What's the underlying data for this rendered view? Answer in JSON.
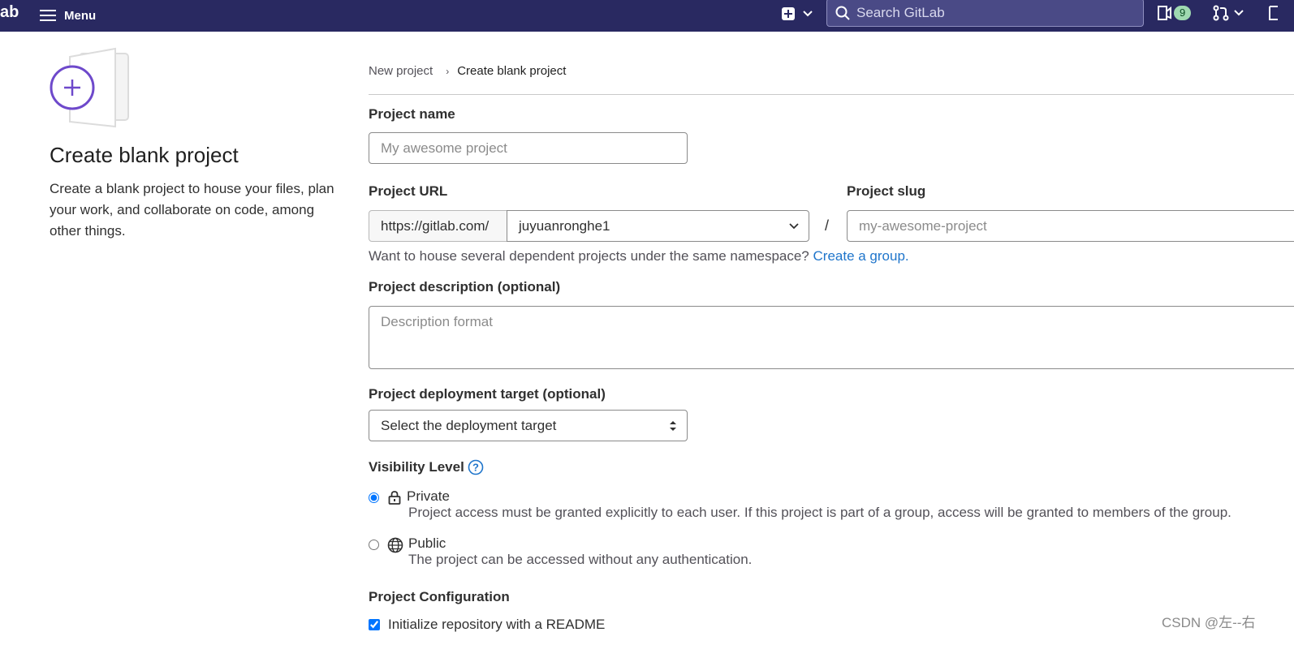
{
  "topbar": {
    "brand": "ab",
    "menu_label": "Menu",
    "search_placeholder": "Search GitLab",
    "issues_count": "9",
    "background_color": "#292961"
  },
  "sidebar": {
    "heading": "Create blank project",
    "description": "Create a blank project to house your files, plan your work, and collaborate on code, among other things.",
    "illustration_icon": "plus-icon"
  },
  "breadcrumb": {
    "parent": "New project",
    "current": "Create blank project"
  },
  "form": {
    "project_name_label": "Project name",
    "project_name_placeholder": "My awesome project",
    "project_url_label": "Project URL",
    "url_prefix": "https://gitlab.com/",
    "namespace_value": "juyuanronghe1",
    "slash": "/",
    "project_slug_label": "Project slug",
    "project_slug_placeholder": "my-awesome-project",
    "namespace_help": "Want to house several dependent projects under the same namespace?",
    "create_group_link": "Create a group.",
    "description_label": "Project description (optional)",
    "description_placeholder": "Description format",
    "deployment_label": "Project deployment target (optional)",
    "deployment_value": "Select the deployment target",
    "visibility_label": "Visibility Level",
    "visibility_options": [
      {
        "title": "Private",
        "description": "Project access must be granted explicitly to each user. If this project is part of a group, access will be granted to members of the group.",
        "checked": true,
        "icon": "lock-icon"
      },
      {
        "title": "Public",
        "description": "The project can be accessed without any authentication.",
        "checked": false,
        "icon": "globe-icon"
      }
    ],
    "config_label": "Project Configuration",
    "readme_label": "Initialize repository with a README",
    "readme_checked": true
  },
  "watermark": "CSDN @左--右",
  "colors": {
    "accent": "#6e49cb",
    "link": "#1f75cb",
    "radio_checked": "#1f75cb"
  }
}
